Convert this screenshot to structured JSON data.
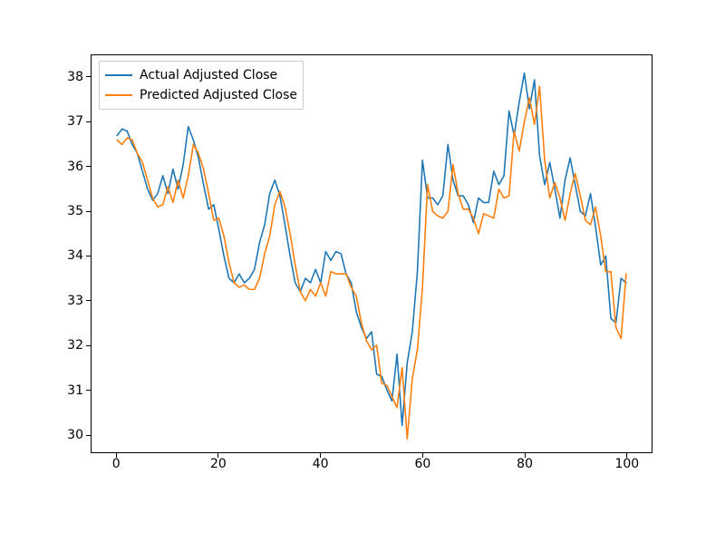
{
  "chart_data": {
    "type": "line",
    "x": [
      0,
      1,
      2,
      3,
      4,
      5,
      6,
      7,
      8,
      9,
      10,
      11,
      12,
      13,
      14,
      15,
      16,
      17,
      18,
      19,
      20,
      21,
      22,
      23,
      24,
      25,
      26,
      27,
      28,
      29,
      30,
      31,
      32,
      33,
      34,
      35,
      36,
      37,
      38,
      39,
      40,
      41,
      42,
      43,
      44,
      45,
      46,
      47,
      48,
      49,
      50,
      51,
      52,
      53,
      54,
      55,
      56,
      57,
      58,
      59,
      60,
      61,
      62,
      63,
      64,
      65,
      66,
      67,
      68,
      69,
      70,
      71,
      72,
      73,
      74,
      75,
      76,
      77,
      78,
      79,
      80,
      81,
      82,
      83,
      84,
      85,
      86,
      87,
      88,
      89,
      90,
      91,
      92,
      93,
      94,
      95,
      96,
      97,
      98,
      99,
      100
    ],
    "series": [
      {
        "name": "Actual Adjusted Close",
        "color": "#1f77b4",
        "values": [
          36.7,
          36.85,
          36.8,
          36.5,
          36.3,
          35.9,
          35.5,
          35.25,
          35.4,
          35.8,
          35.4,
          35.95,
          35.5,
          36.05,
          36.9,
          36.6,
          36.2,
          35.6,
          35.05,
          35.15,
          34.6,
          34.0,
          33.5,
          33.4,
          33.6,
          33.4,
          33.5,
          33.7,
          34.3,
          34.7,
          35.4,
          35.7,
          35.35,
          34.7,
          34.0,
          33.4,
          33.2,
          33.5,
          33.4,
          33.7,
          33.4,
          34.1,
          33.9,
          34.1,
          34.05,
          33.6,
          33.4,
          32.75,
          32.4,
          32.15,
          32.3,
          31.35,
          31.3,
          31.0,
          30.75,
          31.8,
          30.2,
          31.6,
          32.3,
          33.65,
          36.15,
          35.3,
          35.3,
          35.15,
          35.35,
          36.5,
          35.7,
          35.35,
          35.35,
          35.15,
          34.75,
          35.3,
          35.2,
          35.2,
          35.9,
          35.6,
          35.8,
          37.25,
          36.7,
          37.45,
          38.1,
          37.3,
          37.95,
          36.25,
          35.6,
          36.1,
          35.5,
          34.85,
          35.7,
          36.2,
          35.6,
          35.0,
          34.9,
          35.4,
          34.65,
          33.8,
          34.0,
          32.6,
          32.5,
          33.5,
          33.4
        ]
      },
      {
        "name": "Predicted Adjusted Close",
        "color": "#ff7f0e",
        "values": [
          36.6,
          36.5,
          36.65,
          36.6,
          36.3,
          36.1,
          35.7,
          35.3,
          35.1,
          35.15,
          35.55,
          35.2,
          35.7,
          35.3,
          35.8,
          36.5,
          36.3,
          35.95,
          35.4,
          34.8,
          34.85,
          34.45,
          33.85,
          33.4,
          33.3,
          33.35,
          33.25,
          33.25,
          33.5,
          34.05,
          34.45,
          35.15,
          35.45,
          35.1,
          34.5,
          33.8,
          33.2,
          33.0,
          33.25,
          33.1,
          33.4,
          33.1,
          33.65,
          33.6,
          33.6,
          33.6,
          33.3,
          33.1,
          32.5,
          32.1,
          31.9,
          32.0,
          31.15,
          31.1,
          30.85,
          30.6,
          31.5,
          29.9,
          31.25,
          31.9,
          33.3,
          35.6,
          35.0,
          34.9,
          34.85,
          35.0,
          36.05,
          35.4,
          35.05,
          35.05,
          34.85,
          34.5,
          34.95,
          34.9,
          34.85,
          35.5,
          35.3,
          35.35,
          36.8,
          36.35,
          37.0,
          37.55,
          36.95,
          37.8,
          36.15,
          35.3,
          35.65,
          35.3,
          34.8,
          35.4,
          35.85,
          35.35,
          34.8,
          34.7,
          35.1,
          34.45,
          33.65,
          33.65,
          32.4,
          32.15,
          33.6
        ]
      }
    ],
    "xlim": [
      -5,
      105
    ],
    "ylim": [
      29.6,
      38.5
    ],
    "xticks": [
      0,
      20,
      40,
      60,
      80,
      100
    ],
    "yticks": [
      30,
      31,
      32,
      33,
      34,
      35,
      36,
      37,
      38
    ],
    "title": "",
    "xlabel": "",
    "ylabel": "",
    "legend_position": "upper-left"
  },
  "legend": {
    "actual": "Actual Adjusted Close",
    "predicted": "Predicted Adjusted Close"
  },
  "xtick_labels": {
    "0": "0",
    "20": "20",
    "40": "40",
    "60": "60",
    "80": "80",
    "100": "100"
  },
  "ytick_labels": {
    "30": "30",
    "31": "31",
    "32": "32",
    "33": "33",
    "34": "34",
    "35": "35",
    "36": "36",
    "37": "37",
    "38": "38"
  }
}
